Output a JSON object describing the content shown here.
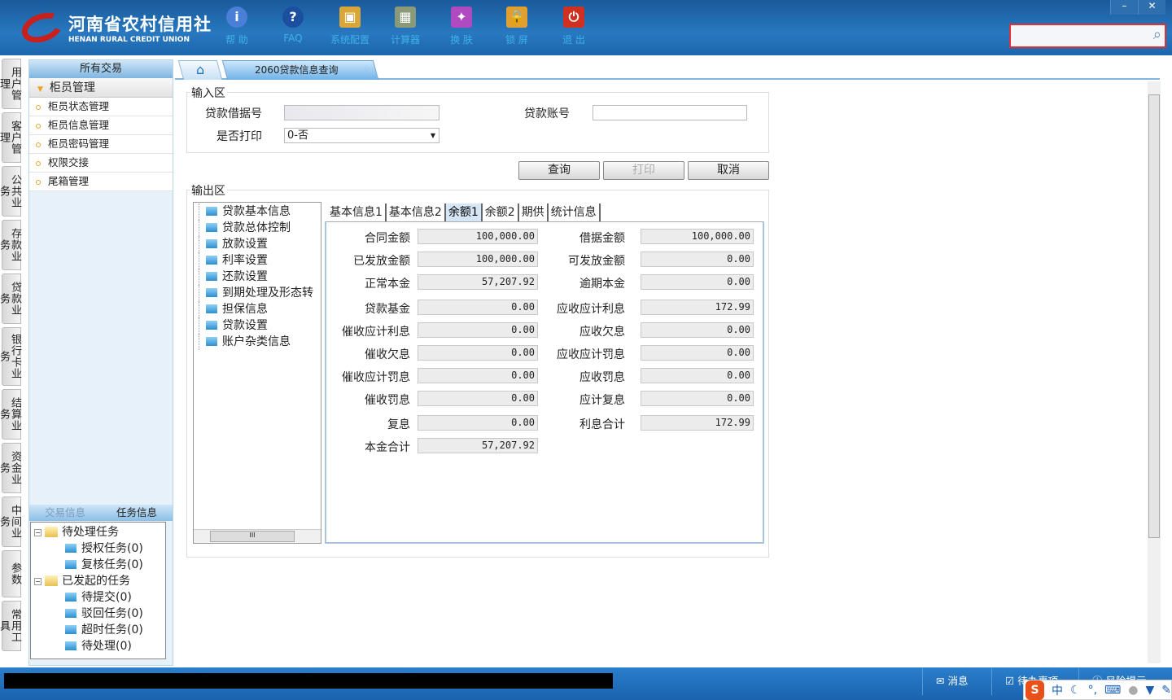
{
  "header": {
    "logo_cn": "河南省农村信用社",
    "logo_en": "HENAN RURAL CREDIT UNION",
    "tools": [
      {
        "label": "帮 助",
        "icon": "info-icon",
        "color": "#4a7fd8",
        "glyph": "i"
      },
      {
        "label": "FAQ",
        "icon": "help-icon",
        "color": "#1c4fa0",
        "glyph": "?"
      },
      {
        "label": "系统配置",
        "icon": "toolbox-icon",
        "color": "#d9a63a",
        "glyph": "▣"
      },
      {
        "label": "计算器",
        "icon": "calculator-icon",
        "color": "#8a9a78",
        "glyph": "▦"
      },
      {
        "label": "换 肤",
        "icon": "skin-shirt-icon",
        "color": "#b04ac0",
        "glyph": "✦"
      },
      {
        "label": "锁 屏",
        "icon": "lock-icon",
        "color": "#e0a030",
        "glyph": "🔒"
      },
      {
        "label": "退 出",
        "icon": "power-icon",
        "color": "#d03020",
        "glyph": "⏻"
      }
    ],
    "window": [
      "–",
      "✕"
    ]
  },
  "vtabs": [
    "用户管理",
    "客户管理",
    "公共业务",
    "存款业务",
    "贷款业务",
    "银行卡业务",
    "结算业务",
    "资金业务",
    "中间业务",
    "参数",
    "常用工具"
  ],
  "sidebar": {
    "title": "所有交易",
    "group": "柜员管理",
    "items": [
      "柜员状态管理",
      "柜员信息管理",
      "柜员密码管理",
      "权限交接",
      "尾箱管理"
    ],
    "tabs": [
      "交易信息",
      "任务信息"
    ],
    "tasks": [
      {
        "label": "待处理任务",
        "children": [
          "授权任务(0)",
          "复核任务(0)"
        ]
      },
      {
        "label": "已发起的任务",
        "children": [
          "待提交(0)",
          "驳回任务(0)",
          "超时任务(0)",
          "待处理(0)"
        ]
      }
    ]
  },
  "tabs": {
    "home_icon": "⌂",
    "active": "2060贷款信息查询",
    "close": "×"
  },
  "input": {
    "legend": "输入区",
    "loan_no_label": "贷款借据号",
    "loan_acct_label": "贷款账号",
    "print_label": "是否打印",
    "print_value": "0-否"
  },
  "buttons": {
    "query": "查询",
    "print": "打印",
    "cancel": "取消"
  },
  "output": {
    "legend": "输出区",
    "tree": [
      "贷款基本信息",
      "贷款总体控制",
      "放款设置",
      "利率设置",
      "还款设置",
      "到期处理及形态转",
      "担保信息",
      "贷款设置",
      "账户杂类信息"
    ],
    "tabs": [
      "基本信息1",
      "基本信息2",
      "余额1",
      "余额2",
      "期供",
      "统计信息"
    ],
    "active_tab": 2,
    "rows": [
      [
        [
          "合同金额",
          "100,000.00"
        ],
        [
          "借据金额",
          "100,000.00"
        ]
      ],
      [
        [
          "已发放金额",
          "100,000.00"
        ],
        [
          "可发放金额",
          "0.00"
        ]
      ],
      [
        [
          "正常本金",
          "57,207.92"
        ],
        [
          "逾期本金",
          "0.00"
        ]
      ],
      [
        [
          "贷款基金",
          "0.00"
        ],
        [
          "应收应计利息",
          "172.99"
        ]
      ],
      [
        [
          "催收应计利息",
          "0.00"
        ],
        [
          "应收欠息",
          "0.00"
        ]
      ],
      [
        [
          "催收欠息",
          "0.00"
        ],
        [
          "应收应计罚息",
          "0.00"
        ]
      ],
      [
        [
          "催收应计罚息",
          "0.00"
        ],
        [
          "应收罚息",
          "0.00"
        ]
      ],
      [
        [
          "催收罚息",
          "0.00"
        ],
        [
          "应计复息",
          "0.00"
        ]
      ],
      [
        [
          "复息",
          "0.00"
        ],
        [
          "利息合计",
          "172.99"
        ]
      ],
      [
        [
          "本金合计",
          "57,207.92"
        ]
      ]
    ]
  },
  "status": {
    "messages": "消息",
    "todo": "待办事项",
    "risk": "风险提示"
  },
  "ime": {
    "lang": "中"
  }
}
